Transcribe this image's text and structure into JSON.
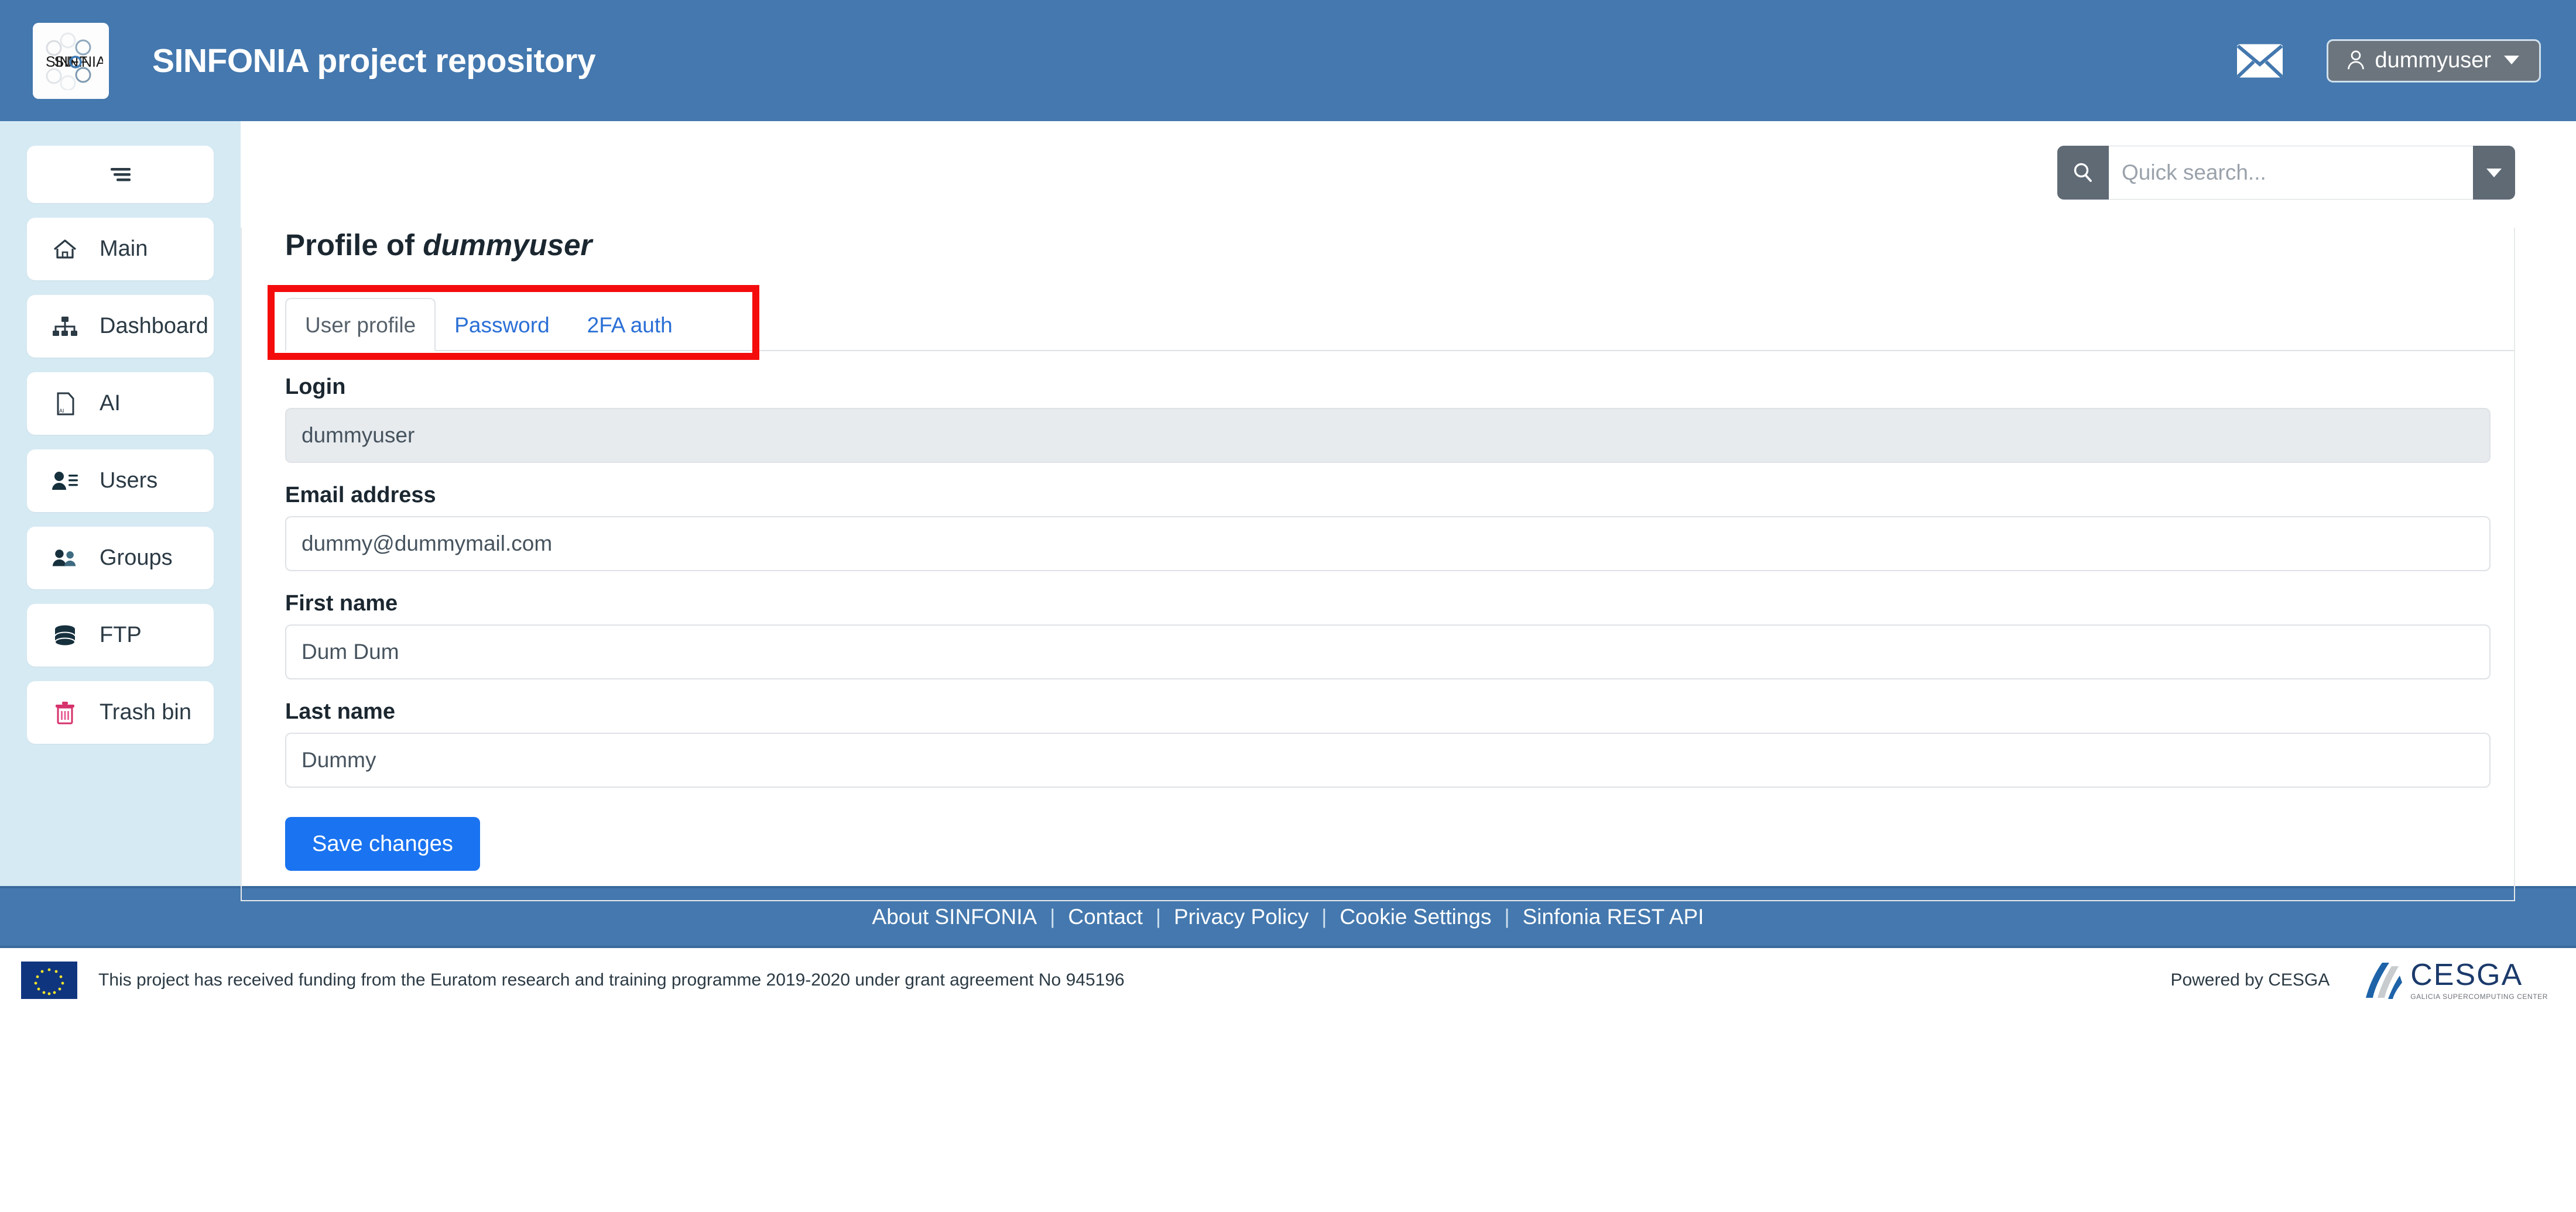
{
  "header": {
    "logo_alt": "SINFONIA",
    "logo_text": "SINFONIA",
    "title": "SINFONIA project repository",
    "mail_icon": "envelope-icon",
    "user_button_label": "dummyuser",
    "user_icon": "person-icon",
    "caret_icon": "caret-down-icon"
  },
  "search": {
    "placeholder": "Quick search...",
    "value": "",
    "search_icon": "search-icon",
    "dropdown_icon": "caret-down-icon"
  },
  "sidebar": {
    "toggle_icon": "hamburger-menu-icon",
    "items": [
      {
        "label": "Main",
        "icon": "home-icon"
      },
      {
        "label": "Dashboard",
        "icon": "sitemap-icon"
      },
      {
        "label": "AI",
        "icon": "ai-file-icon"
      },
      {
        "label": "Users",
        "icon": "user-list-icon"
      },
      {
        "label": "Groups",
        "icon": "users-group-icon"
      },
      {
        "label": "FTP",
        "icon": "database-icon"
      },
      {
        "label": "Trash bin",
        "icon": "trash-icon"
      }
    ]
  },
  "main": {
    "page_title_prefix": "Profile of ",
    "page_title_user": "dummyuser",
    "tabs": [
      {
        "label": "User profile",
        "active": true
      },
      {
        "label": "Password",
        "active": false
      },
      {
        "label": "2FA auth",
        "active": false
      }
    ],
    "annotation": {
      "type": "red-highlight-box",
      "target": "tab-bar"
    },
    "form": {
      "fields": [
        {
          "label": "Login",
          "value": "dummyuser",
          "disabled": true
        },
        {
          "label": "Email address",
          "value": "dummy@dummymail.com",
          "disabled": false
        },
        {
          "label": "First name",
          "value": "Dum Dum",
          "disabled": false
        },
        {
          "label": "Last name",
          "value": "Dummy",
          "disabled": false
        }
      ],
      "save_label": "Save changes"
    }
  },
  "footer": {
    "links": [
      "About SINFONIA",
      "Contact",
      "Privacy Policy",
      "Cookie Settings",
      "Sinfonia REST API"
    ],
    "separator": "|",
    "funding_text": "This project has received funding from the Euratom research and training programme 2019-2020 under grant agreement No 945196",
    "eu_flag_icon": "eu-flag-icon",
    "powered_text": "Powered by CESGA",
    "cesga_name": "CESGA",
    "cesga_tagline": "GALICIA SUPERCOMPUTING CENTER"
  },
  "colors": {
    "header_blue": "#4478ae",
    "sidebar_blue": "#d6eaf3",
    "primary_button": "#1a73f0",
    "link_blue": "#2a6fd6",
    "annotation_red": "#f40c0c",
    "user_button_gray": "#6c757d",
    "trash_pink": "#d6336c"
  }
}
